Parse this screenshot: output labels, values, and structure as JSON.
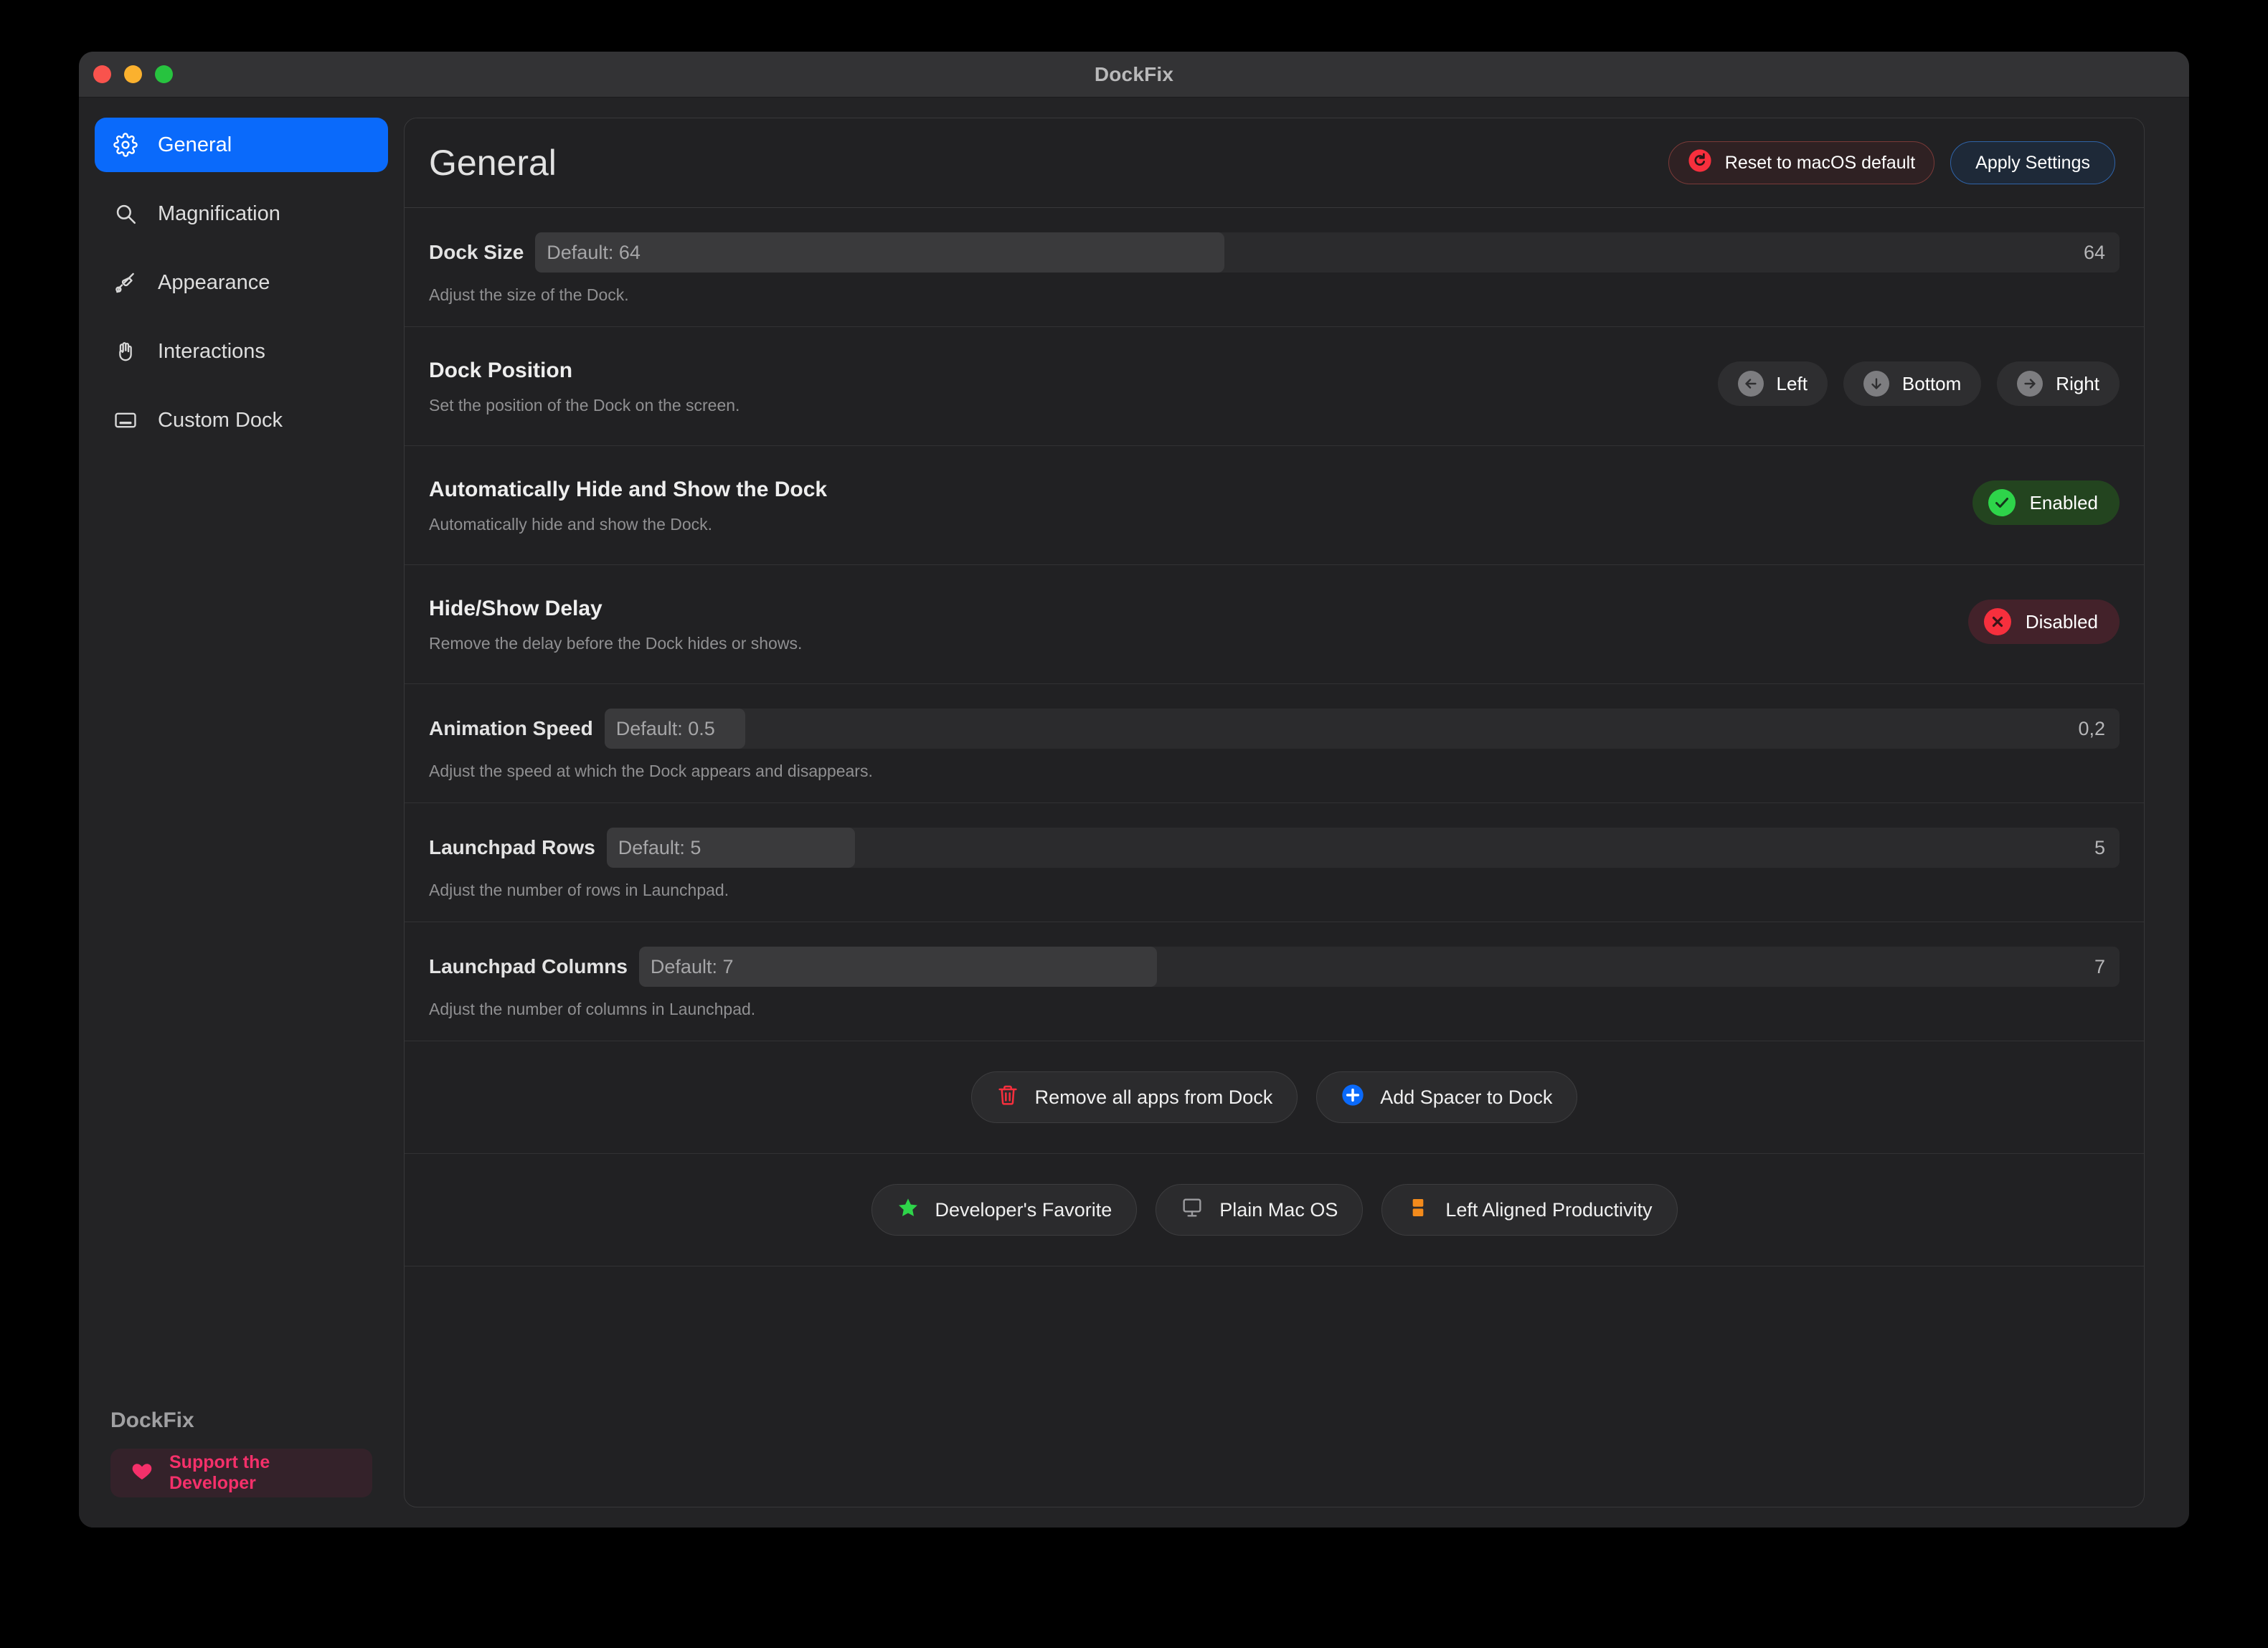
{
  "window": {
    "title": "DockFix",
    "traffic_lights": [
      "close-button",
      "minimize-button",
      "maximize-button"
    ]
  },
  "sidebar": {
    "items": [
      {
        "label": "General",
        "icon": "gear-icon",
        "active": true
      },
      {
        "label": "Magnification",
        "icon": "search-icon",
        "active": false
      },
      {
        "label": "Appearance",
        "icon": "brush-icon",
        "active": false
      },
      {
        "label": "Interactions",
        "icon": "hand-icon",
        "active": false
      },
      {
        "label": "Custom Dock",
        "icon": "dock-icon",
        "active": false
      }
    ],
    "brand_name": "DockFix",
    "support_label": "Support the Developer",
    "support_icon": "heart-icon"
  },
  "header": {
    "page_title": "General",
    "reset_label": "Reset to macOS default",
    "reset_icon": "reset-circle-icon",
    "apply_label": "Apply Settings"
  },
  "settings": {
    "dock_size": {
      "label": "Dock Size",
      "placeholder": "Default: 64",
      "value": "64",
      "fill_percent": 43.5,
      "description": "Adjust the size of the Dock."
    },
    "dock_position": {
      "title": "Dock Position",
      "description": "Set the position of the Dock on the screen.",
      "options": [
        {
          "label": "Left",
          "icon": "arrow-left-circle-icon"
        },
        {
          "label": "Bottom",
          "icon": "arrow-down-circle-icon"
        },
        {
          "label": "Right",
          "icon": "arrow-right-circle-icon"
        }
      ]
    },
    "auto_hide": {
      "title": "Automatically Hide and Show the Dock",
      "description": "Automatically hide and show the Dock.",
      "status_label": "Enabled",
      "status_icon": "check-circle-icon",
      "status_state": "enabled"
    },
    "hide_show_delay": {
      "title": "Hide/Show Delay",
      "description": "Remove the delay before the Dock hides or shows.",
      "status_label": "Disabled",
      "status_icon": "x-circle-icon",
      "status_state": "disabled"
    },
    "animation_speed": {
      "label": "Animation Speed",
      "placeholder": "Default: 0.5",
      "value": "0,2",
      "fill_percent": 9.3,
      "description": "Adjust the speed at which the Dock appears and disappears."
    },
    "launchpad_rows": {
      "label": "Launchpad Rows",
      "placeholder": "Default: 5",
      "value": "5",
      "fill_percent": 16.4,
      "description": "Adjust the number of rows in Launchpad."
    },
    "launchpad_columns": {
      "label": "Launchpad Columns",
      "placeholder": "Default: 7",
      "value": "7",
      "fill_percent": 35.0,
      "description": "Adjust the number of columns in Launchpad."
    }
  },
  "dock_actions": [
    {
      "label": "Remove all apps from Dock",
      "icon": "trash-icon"
    },
    {
      "label": "Add Spacer to Dock",
      "icon": "plus-circle-icon"
    }
  ],
  "presets": [
    {
      "label": "Developer's Favorite",
      "icon": "star-icon"
    },
    {
      "label": "Plain Mac OS",
      "icon": "display-icon"
    },
    {
      "label": "Left Aligned Productivity",
      "icon": "layout-blocks-icon"
    }
  ],
  "colors": {
    "accent_blue": "#0a6afb",
    "danger_red": "#f72f3d",
    "success_green": "#2ed44a",
    "pink": "#f5306a",
    "orange": "#f38b1c",
    "window_bg": "#232325",
    "panel_bg": "#212123"
  }
}
